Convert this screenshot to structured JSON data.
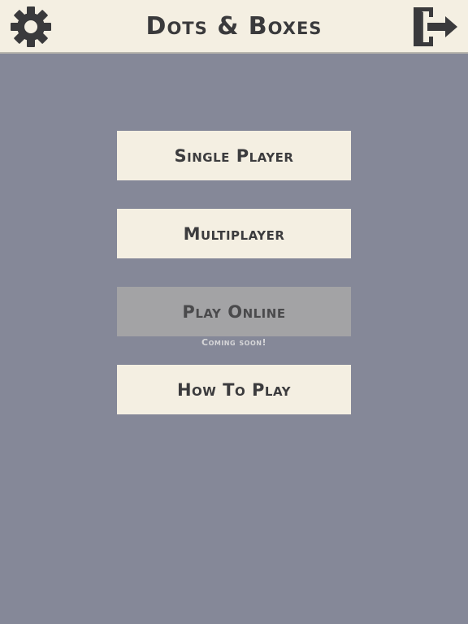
{
  "header": {
    "title": "Dots & Boxes",
    "left_icon": "gear-icon",
    "right_icon": "exit-door-icon"
  },
  "menu": {
    "single_player": "Single Player",
    "multiplayer": "Multiplayer",
    "play_online": "Play Online",
    "coming_soon": "Coming soon!",
    "how_to_play": "How To Play"
  },
  "colors": {
    "background": "#858898",
    "button": "#f4efe2",
    "button_disabled": "#a3a3a5",
    "text": "#3c3c3e"
  }
}
